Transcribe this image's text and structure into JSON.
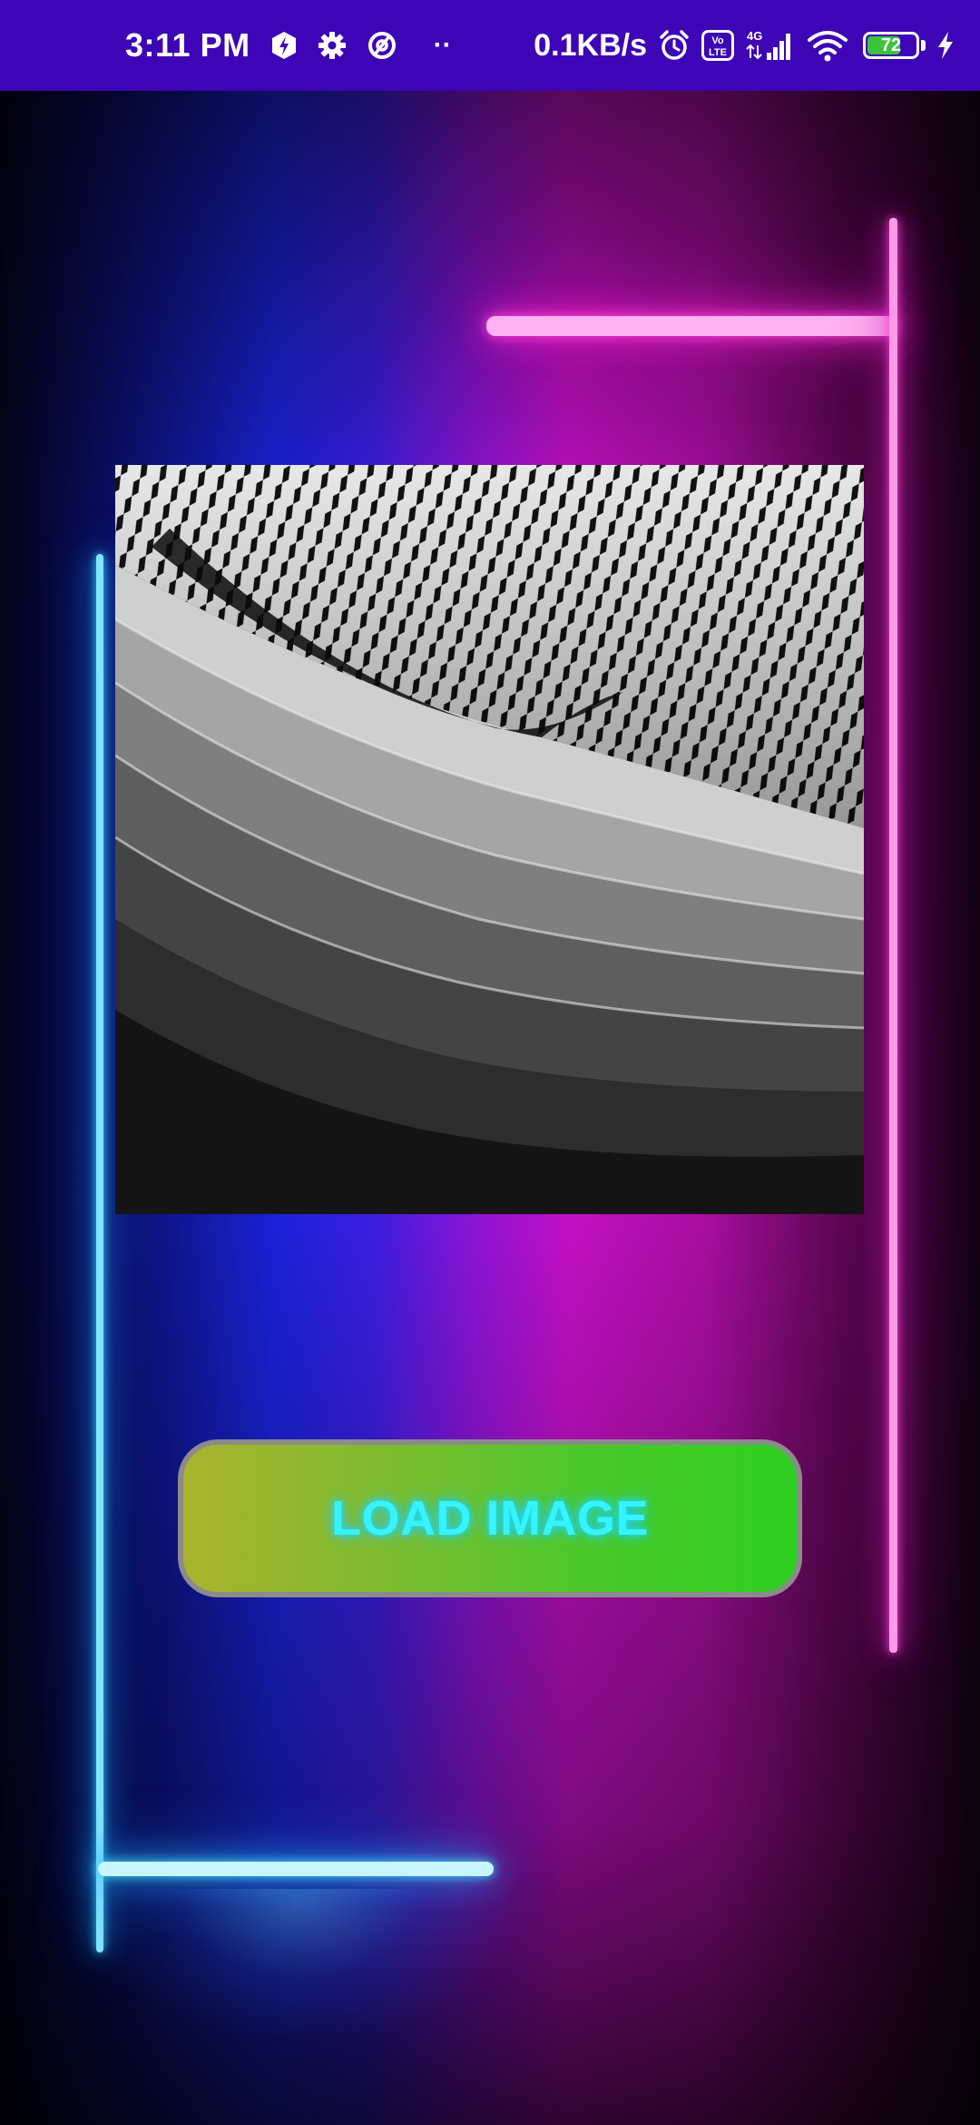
{
  "status_bar": {
    "time": "3:11 PM",
    "more": "··",
    "network_speed": "0.1KB/s",
    "volte_label": "Vo LTE",
    "network_type": "4G",
    "battery_level": "72",
    "battery_fraction": 0.72,
    "icons": [
      "bolt-badge-icon",
      "gear-icon",
      "at-sign-icon",
      "more-dots-icon",
      "alarm-icon",
      "volte-icon",
      "signal-icon",
      "wifi-icon",
      "battery-icon",
      "charging-icon"
    ],
    "background_color": "#3d05b5"
  },
  "main": {
    "image_description_icon": "abstract-architecture-photo",
    "load_button": {
      "label": "LOAD IMAGE",
      "label_color": "#35f4ff",
      "gradient": [
        "#a9b42e",
        "#2ecf20"
      ]
    }
  },
  "theme": {
    "neon_blue": "#49d8ff",
    "neon_pink": "#ff4ad8"
  }
}
